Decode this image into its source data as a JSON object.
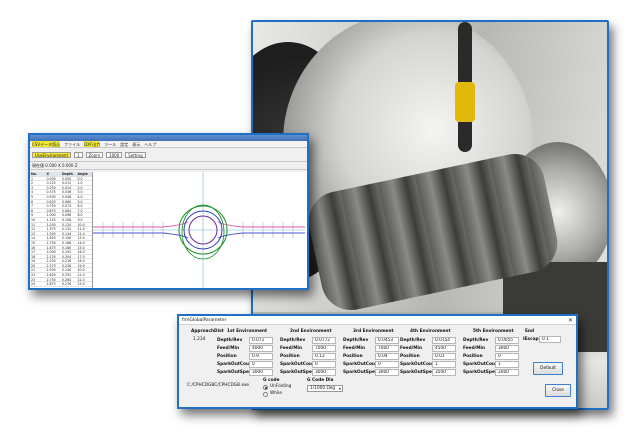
{
  "plot_window": {
    "menu_items": [
      "CSVデータ読込",
      "ファイル",
      "DXF出力",
      "ツール",
      "設定",
      "表示",
      "ヘルプ"
    ],
    "toolbar_fields": [
      "UseEnvironment",
      "1",
      "Zoom",
      "1000",
      "Setting"
    ],
    "status_text": "現在値 0.000 X 0.000 Z",
    "table_headers": [
      "No.",
      "X",
      "Depth",
      "Angle"
    ],
    "table_rows": [
      [
        "1",
        "0.000",
        "0.000",
        "0.0"
      ],
      [
        "2",
        "0.125",
        "0.012",
        "1.0"
      ],
      [
        "3",
        "0.250",
        "0.024",
        "2.0"
      ],
      [
        "4",
        "0.375",
        "0.036",
        "3.0"
      ],
      [
        "5",
        "0.500",
        "0.048",
        "4.0"
      ],
      [
        "6",
        "0.625",
        "0.060",
        "5.0"
      ],
      [
        "7",
        "0.750",
        "0.072",
        "6.0"
      ],
      [
        "8",
        "0.875",
        "0.084",
        "7.0"
      ],
      [
        "9",
        "1.000",
        "0.096",
        "8.0"
      ],
      [
        "10",
        "1.125",
        "0.108",
        "9.0"
      ],
      [
        "11",
        "1.250",
        "0.120",
        "10.0"
      ],
      [
        "12",
        "1.375",
        "0.132",
        "11.0"
      ],
      [
        "13",
        "1.500",
        "0.144",
        "12.0"
      ],
      [
        "14",
        "1.625",
        "0.156",
        "13.0"
      ],
      [
        "15",
        "1.750",
        "0.168",
        "14.0"
      ],
      [
        "16",
        "1.875",
        "0.180",
        "15.0"
      ],
      [
        "17",
        "2.000",
        "0.192",
        "16.0"
      ],
      [
        "18",
        "2.125",
        "0.204",
        "17.0"
      ],
      [
        "19",
        "2.250",
        "0.216",
        "18.0"
      ],
      [
        "20",
        "2.375",
        "0.228",
        "19.0"
      ],
      [
        "21",
        "2.500",
        "0.240",
        "20.0"
      ],
      [
        "22",
        "2.625",
        "0.252",
        "21.0"
      ],
      [
        "23",
        "2.750",
        "0.264",
        "22.0"
      ],
      [
        "24",
        "2.875",
        "0.276",
        "23.0"
      ]
    ]
  },
  "dialog": {
    "title": "frmGlobalParameter",
    "approach_dist_label": "ApproachDist",
    "approach_dist_value": "1.234",
    "environments": [
      {
        "name": "1st Environment",
        "depth": "0.071",
        "feed": "4000",
        "position": "0.9",
        "spark_count": "0",
        "spark_speed": "3000"
      },
      {
        "name": "2nd Environment",
        "depth": "0.0772",
        "feed": "7000",
        "position": "0.13",
        "spark_count": "0",
        "spark_speed": "3000"
      },
      {
        "name": "3rd Environment",
        "depth": "0.0453",
        "feed": "7000",
        "position": "0.04",
        "spark_count": "0",
        "spark_speed": "3000"
      },
      {
        "name": "4th Environment",
        "depth": "0.0154",
        "feed": "4500",
        "position": "0.01",
        "spark_count": "1",
        "spark_speed": "3500"
      },
      {
        "name": "5th Environment",
        "depth": "0.0055",
        "feed": "3000",
        "position": "0",
        "spark_count": "1",
        "spark_speed": "2000"
      }
    ],
    "row_labels": [
      "Depth/Rev",
      "Feed/Min",
      "Position",
      "SparkOutCount",
      "SparkOutSpeed"
    ],
    "end_label": "End",
    "escape_label": "IEscape",
    "escape_value": "0.1",
    "file_path": "C:/CPHCDGBC/CPHCDGB.exe",
    "gcode_label": "G code",
    "gcode_options": [
      "UnFolding",
      "While"
    ],
    "gcode_selected": "UnFolding",
    "gcode_dia_label": "G Code Dia",
    "gcode_dia_value": "1/1000 Deg",
    "default_button": "Default",
    "close_button": "Close"
  }
}
